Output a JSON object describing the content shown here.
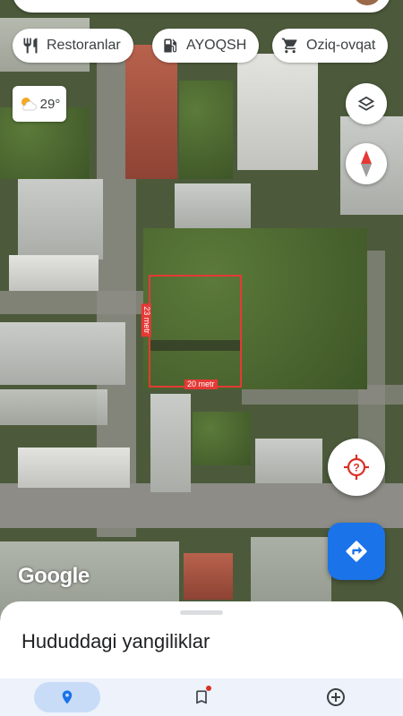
{
  "chips": [
    {
      "label": "Restoranlar",
      "icon": "restaurant-icon"
    },
    {
      "label": "AYOQSH",
      "icon": "gas-station-icon"
    },
    {
      "label": "Oziq-ovqat",
      "icon": "shopping-cart-icon"
    }
  ],
  "weather": {
    "temp": "29°",
    "icon": "partly-sunny-icon"
  },
  "measurement": {
    "width_label": "20 metr",
    "height_label": "23 metr"
  },
  "map": {
    "logo": "Google"
  },
  "sheet": {
    "title": "Hududdagi yangiliklar"
  },
  "navbar": {
    "items": [
      {
        "name": "explore",
        "icon": "location-pin-icon",
        "active": true
      },
      {
        "name": "saved",
        "icon": "bookmark-icon",
        "badge": true
      },
      {
        "name": "contribute",
        "icon": "add-circle-icon"
      }
    ]
  },
  "colors": {
    "accent": "#1a73e8",
    "alert": "#d93025",
    "measure": "#e53935"
  }
}
